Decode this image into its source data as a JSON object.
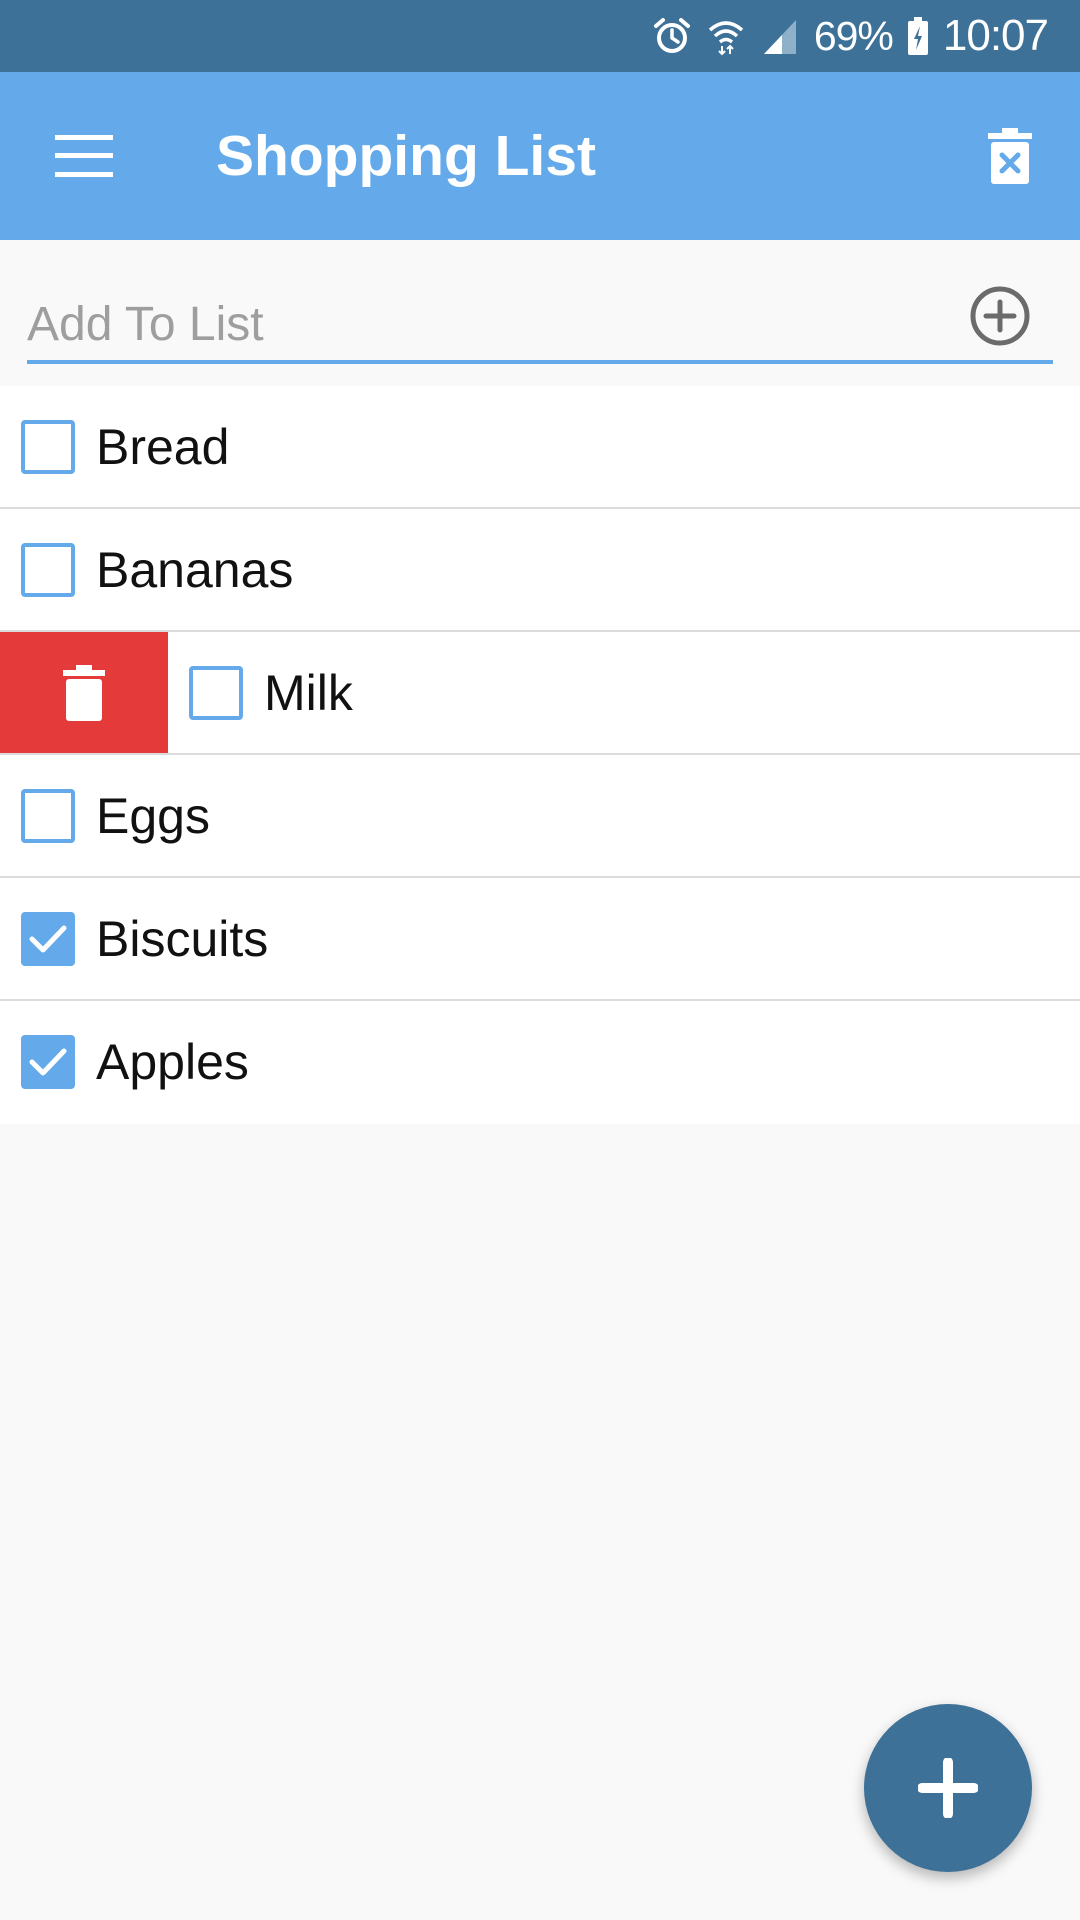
{
  "status_bar": {
    "battery_percent": "69%",
    "time": "10:07",
    "icons": [
      "alarm-icon",
      "wifi-icon",
      "signal-icon",
      "battery-charging-icon"
    ]
  },
  "app_bar": {
    "title": "Shopping List",
    "menu_icon": "hamburger-menu-icon",
    "clear_icon": "delete-all-icon"
  },
  "add_item": {
    "placeholder": "Add To List",
    "value": "",
    "button_icon": "add-circle-icon"
  },
  "items": [
    {
      "label": "Bread",
      "checked": false
    },
    {
      "label": "Bananas",
      "checked": false
    },
    {
      "label": "Milk",
      "checked": false,
      "swiped": true
    },
    {
      "label": "Eggs",
      "checked": false
    },
    {
      "label": "Biscuits",
      "checked": true
    },
    {
      "label": "Apples",
      "checked": true
    }
  ],
  "fab": {
    "icon": "plus-icon"
  },
  "colors": {
    "status_bar": "#3d7198",
    "app_bar": "#64aaeb",
    "accent": "#64aaeb",
    "delete": "#e53a3a",
    "fab": "#3d7198"
  }
}
